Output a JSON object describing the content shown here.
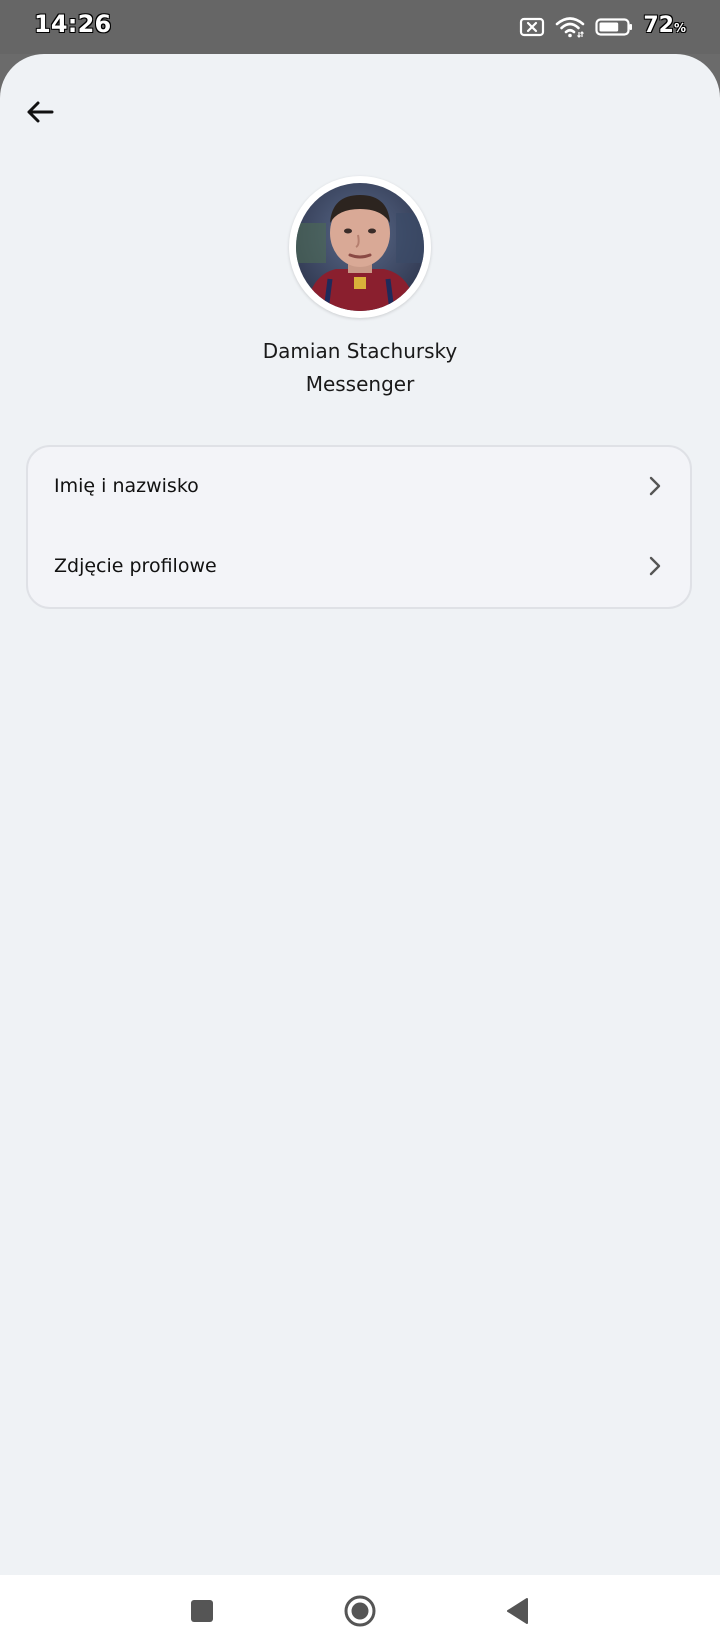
{
  "status_bar": {
    "time": "14:26",
    "battery_percent": "72",
    "battery_unit": "%",
    "battery_level": 0.72,
    "icons": [
      "no-sim-icon",
      "wifi-icon",
      "battery-icon"
    ]
  },
  "header": {
    "back_icon": "arrow-left-icon"
  },
  "profile": {
    "name": "Damian Stachursky",
    "app": "Messenger"
  },
  "settings": {
    "items": [
      {
        "label": "Imię i nazwisko",
        "icon": "chevron-right-icon"
      },
      {
        "label": "Zdjęcie profilowe",
        "icon": "chevron-right-icon"
      }
    ]
  },
  "nav_bar": {
    "buttons": [
      "recents-icon",
      "home-icon",
      "back-triangle-icon"
    ]
  },
  "colors": {
    "background": "#eff2f5",
    "card": "#f3f4f8",
    "status_bar": "#666666",
    "text": "#111111"
  }
}
